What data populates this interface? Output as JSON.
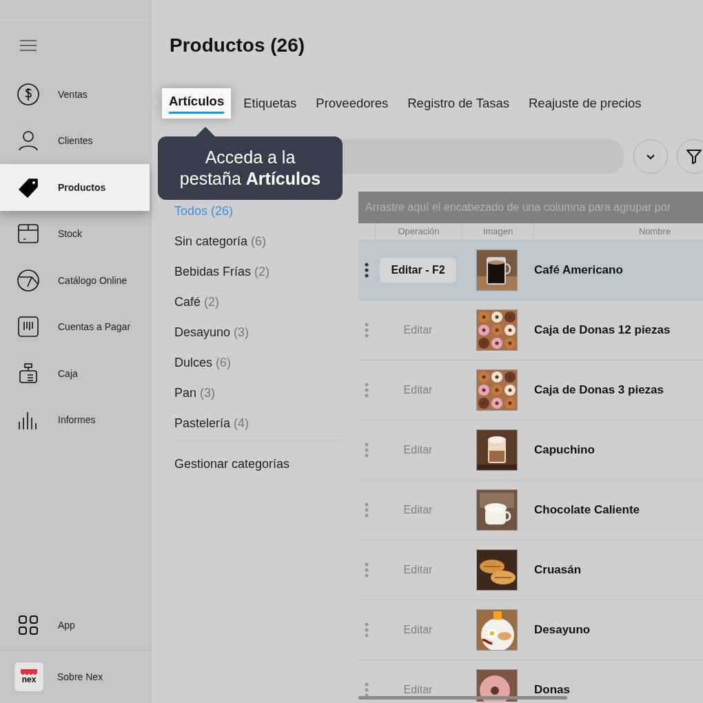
{
  "sidebar": {
    "items": [
      {
        "label": "Ventas",
        "kind": "dollar",
        "selected": false
      },
      {
        "label": "Clientes",
        "kind": "person",
        "selected": false
      },
      {
        "label": "Productos",
        "kind": "tag",
        "selected": true
      },
      {
        "label": "Stock",
        "kind": "box",
        "selected": false
      },
      {
        "label": "Catálogo Online",
        "kind": "catalog",
        "selected": false
      },
      {
        "label": "Cuentas a Pagar",
        "kind": "bill",
        "selected": false
      },
      {
        "label": "Caja",
        "kind": "register",
        "selected": false
      },
      {
        "label": "Informes",
        "kind": "bars",
        "selected": false
      }
    ],
    "app": {
      "label": "App"
    },
    "about": {
      "label": "Sobre Nex",
      "logo_text": "nex"
    }
  },
  "page_title": "Productos (26)",
  "tabs": [
    {
      "label": "Artículos",
      "selected": true
    },
    {
      "label": "Etiquetas",
      "selected": false
    },
    {
      "label": "Proveedores",
      "selected": false
    },
    {
      "label": "Registro de Tasas",
      "selected": false
    },
    {
      "label": "Reajuste de precios",
      "selected": false
    }
  ],
  "tooltip": {
    "text": "Acceda a la\npestaña **Artículos**"
  },
  "categories": [
    {
      "name": "Todos",
      "count": "(26)",
      "selected": true
    },
    {
      "name": "Sin categoría",
      "count": "(6)",
      "selected": false
    },
    {
      "name": "Bebidas Frías",
      "count": "(2)",
      "selected": false
    },
    {
      "name": "Café",
      "count": "(2)",
      "selected": false
    },
    {
      "name": "Desayuno",
      "count": "(3)",
      "selected": false
    },
    {
      "name": "Dulces",
      "count": "(6)",
      "selected": false
    },
    {
      "name": "Pan",
      "count": "(3)",
      "selected": false
    },
    {
      "name": "Pastelería",
      "count": "(4)",
      "selected": false
    }
  ],
  "manage_categories": "Gestionar categorías",
  "grid": {
    "group_hint": "Arrastre aquí el encabezado de una columna para agrupar por",
    "columns": [
      "Operación",
      "Imagen",
      "Nombre"
    ],
    "rows": [
      {
        "action": "Editar - F2",
        "name": "Café Americano",
        "selected": true
      },
      {
        "action": "Editar",
        "name": "Caja de Donas 12 piezas",
        "selected": false
      },
      {
        "action": "Editar",
        "name": "Caja de Donas 3 piezas",
        "selected": false
      },
      {
        "action": "Editar",
        "name": "Capuchino",
        "selected": false
      },
      {
        "action": "Editar",
        "name": "Chocolate Caliente",
        "selected": false
      },
      {
        "action": "Editar",
        "name": "Cruasán",
        "selected": false
      },
      {
        "action": "Editar",
        "name": "Desayuno",
        "selected": false
      },
      {
        "action": "Editar",
        "name": "Donas",
        "selected": false
      }
    ]
  }
}
